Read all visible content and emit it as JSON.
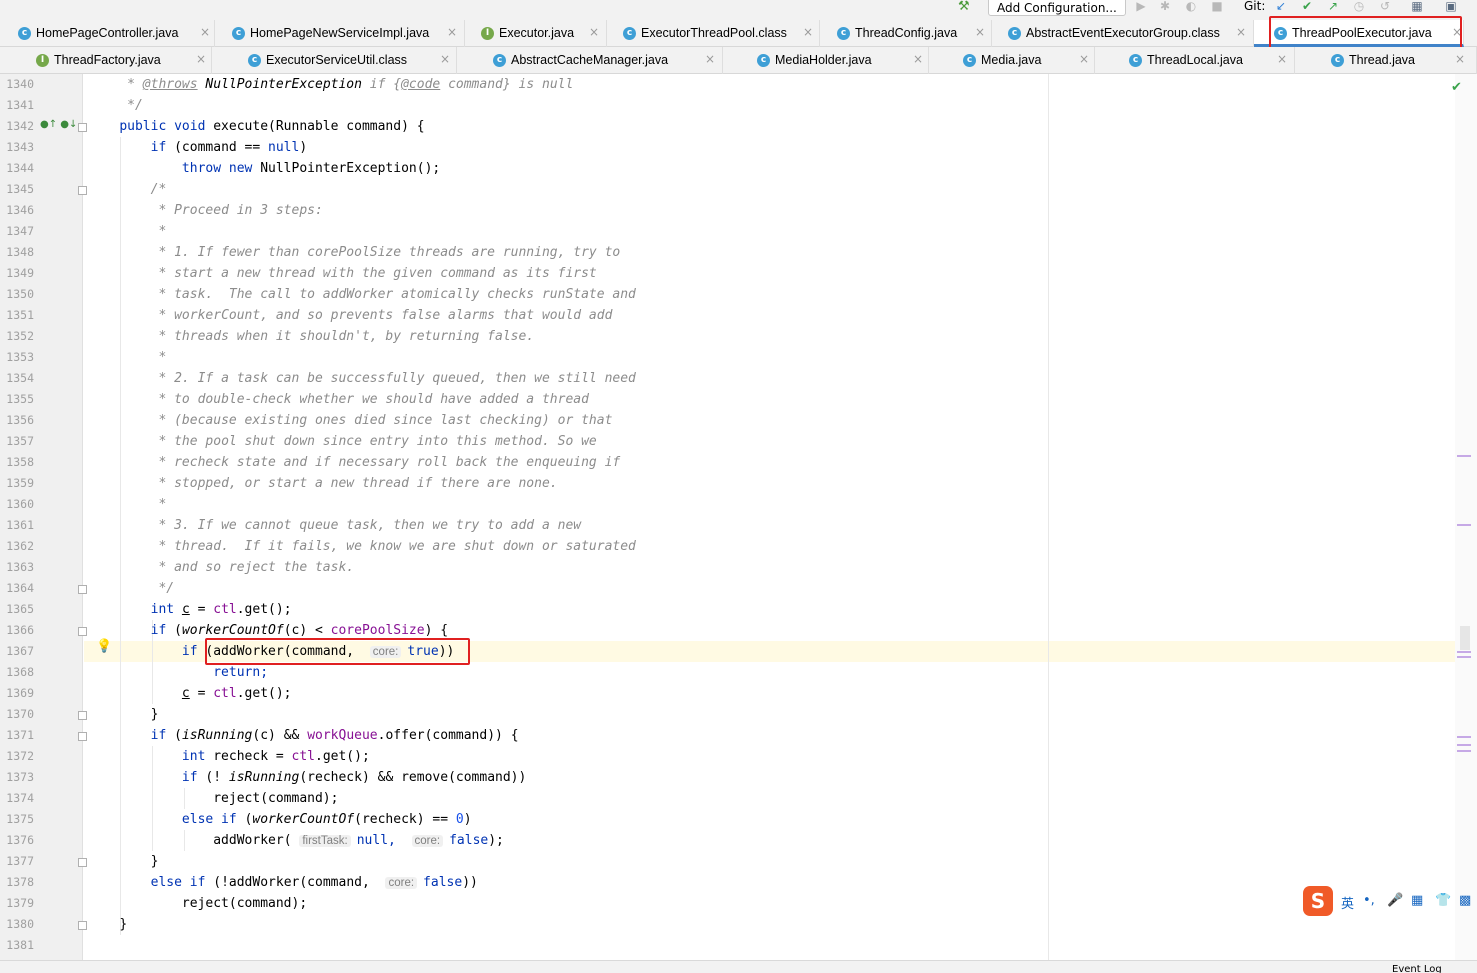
{
  "toolbar": {
    "add_configuration": "Add Configuration...",
    "git_label": "Git:",
    "hammer_icon": "hammer-icon"
  },
  "tabs_row1": [
    {
      "label": "HomePageController.java",
      "kind": "c"
    },
    {
      "label": "HomePageNewServiceImpl.java",
      "kind": "c"
    },
    {
      "label": "Executor.java",
      "kind": "i"
    },
    {
      "label": "ExecutorThreadPool.class",
      "kind": "c"
    },
    {
      "label": "ThreadConfig.java",
      "kind": "c"
    },
    {
      "label": "AbstractEventExecutorGroup.class",
      "kind": "c"
    },
    {
      "label": "ThreadPoolExecutor.java",
      "kind": "c",
      "active": true
    }
  ],
  "tabs_row2": [
    {
      "label": "ThreadFactory.java",
      "kind": "i"
    },
    {
      "label": "ExecutorServiceUtil.class",
      "kind": "c"
    },
    {
      "label": "AbstractCacheManager.java",
      "kind": "c"
    },
    {
      "label": "MediaHolder.java",
      "kind": "c"
    },
    {
      "label": "Media.java",
      "kind": "c"
    },
    {
      "label": "ThreadLocal.java",
      "kind": "c"
    },
    {
      "label": "Thread.java",
      "kind": "c"
    }
  ],
  "tab_close_glyph": "×",
  "editor": {
    "line_numbers": [
      "1340",
      "1341",
      "1342",
      "1343",
      "1344",
      "1345",
      "1346",
      "1347",
      "1348",
      "1349",
      "1350",
      "1351",
      "1352",
      "1353",
      "1354",
      "1355",
      "1356",
      "1357",
      "1358",
      "1359",
      "1360",
      "1361",
      "1362",
      "1363",
      "1364",
      "1365",
      "1366",
      "1367",
      "1368",
      "1369",
      "1370",
      "1371",
      "1372",
      "1373",
      "1374",
      "1375",
      "1376",
      "1377",
      "1378",
      "1379",
      "1380",
      "1381"
    ],
    "current_line": "1367",
    "comment_lines": {
      "l1341": "*/",
      "l1345": "/*",
      "l1346": " * Proceed in 3 steps:",
      "l1347": " *",
      "l1348": " * 1. If fewer than corePoolSize threads are running, try to",
      "l1349": " * start a new thread with the given command as its first",
      "l1350": " * task.  The call to addWorker atomically checks runState and",
      "l1351": " * workerCount, and so prevents false alarms that would add",
      "l1352": " * threads when it shouldn't, by returning false.",
      "l1353": " *",
      "l1354": " * 2. If a task can be successfully queued, then we still need",
      "l1355": " * to double-check whether we should have added a thread",
      "l1356": " * (because existing ones died since last checking) or that",
      "l1357": " * the pool shut down since entry into this method. So we",
      "l1358": " * recheck state and if necessary roll back the enqueuing if",
      "l1359": " * stopped, or start a new thread if there are none.",
      "l1360": " *",
      "l1361": " * 3. If we cannot queue task, then we try to add a new",
      "l1362": " * thread.  If it fails, we know we are shut down or saturated",
      "l1363": " * and so reject the task.",
      "l1364": " */"
    },
    "tokens": {
      "throws_tag": "@throws",
      "npe": "NullPointerException",
      "if_word": "if",
      "code_open": "{",
      "code_tag": "@code",
      "code_rest": "command}",
      "is_null": "is null",
      "star": "*",
      "public_void": "public void",
      "execute_sig": "execute(Runnable command) {",
      "if": "if",
      "cmd_eq": "(command ==",
      "null": "null",
      "rparen": ")",
      "throw": "throw",
      "new": "new",
      "npe_ctor": "NullPointerException();",
      "int": "int",
      "c_var": "c",
      "assign": "=",
      "ctl": "ctl",
      "get_call": ".get();",
      "if_open": "(",
      "workerCountOf": "workerCountOf",
      "c_arg": "(c)",
      "lt": "<",
      "corePoolSize": "corePoolSize",
      "rparen_brace": ") {",
      "add_worker_open": "(addWorker",
      "command_arg": "(command,",
      "hint_core": "core:",
      "true": "true",
      "close2": "))",
      "return": "return;",
      "close_brace": "}",
      "isRunning": "isRunning",
      "and": "&&",
      "workQueue": "workQueue",
      "offer": ".offer(command)) {",
      "recheck_decl": "recheck",
      "not_open": "(!",
      "recheck_arg": "(recheck)",
      "remove": "&& remove(command))",
      "reject": "reject(command);",
      "else_if": "else if",
      "eq_zero": "==",
      "zero": "0",
      "addWorker": "addWorker",
      "open_paren": "(",
      "hint_firstTask": "firstTask:",
      "null_comma": "null,",
      "false": "false",
      "close_semi": ");",
      "not_addworker": "(!",
      "close_double": "))"
    }
  },
  "ime": {
    "logo": "S",
    "lang": "英"
  },
  "status": {
    "event_log": "Event Log"
  }
}
